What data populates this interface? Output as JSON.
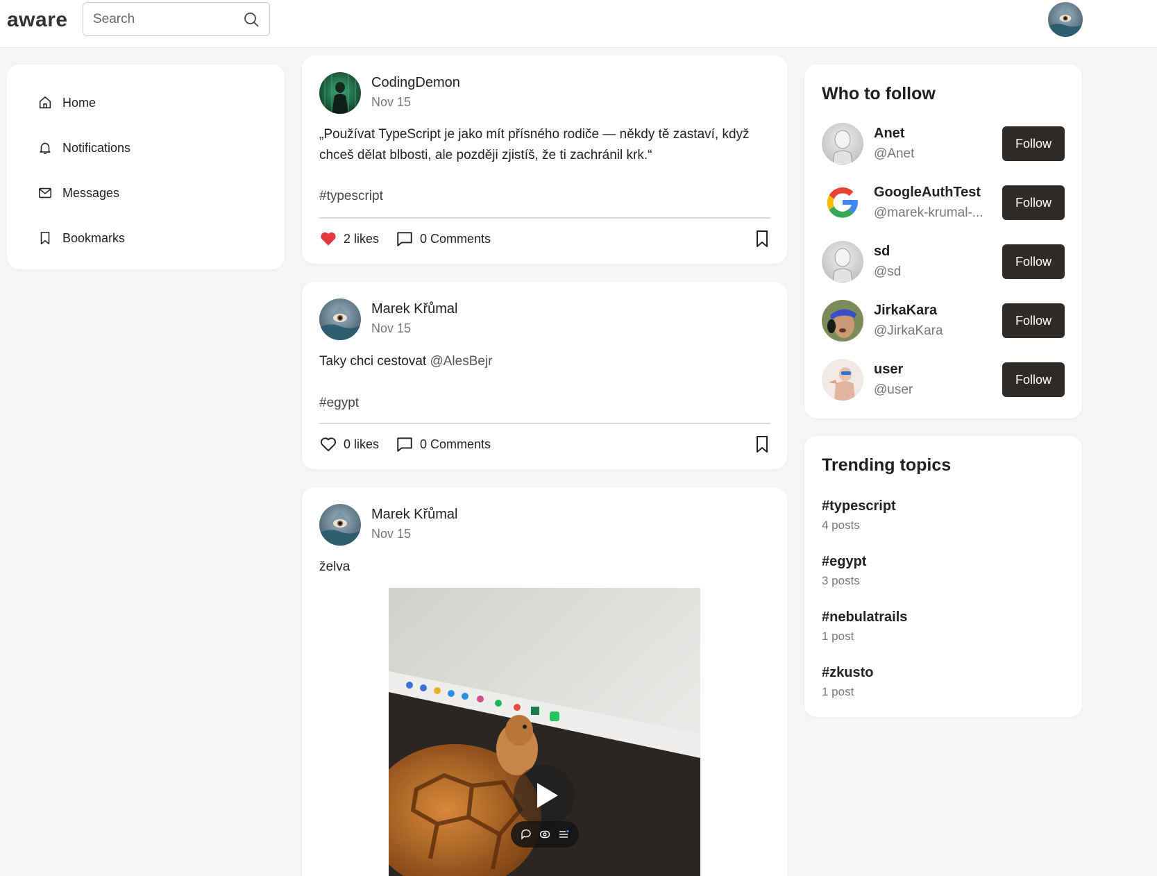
{
  "app": {
    "logo": "aware"
  },
  "search": {
    "placeholder": "Search"
  },
  "nav": {
    "items": [
      {
        "label": "Home",
        "icon": "home-icon"
      },
      {
        "label": "Notifications",
        "icon": "bell-icon"
      },
      {
        "label": "Messages",
        "icon": "mail-icon"
      },
      {
        "label": "Bookmarks",
        "icon": "bookmark-icon"
      }
    ]
  },
  "posts": [
    {
      "author": "CodingDemon",
      "date": "Nov 15",
      "text": "„Používat TypeScript je jako mít přísného rodiče — někdy tě zastaví, když chceš dělat blbosti, ale později zjistíš, že ti zachránil krk.“",
      "hashtag": "#typescript",
      "likes": "2 likes",
      "liked": true,
      "comments": "0 Comments"
    },
    {
      "author": "Marek Křůmal",
      "date": "Nov 15",
      "text": "Taky chci cestovat ",
      "mention": "@AlesBejr",
      "hashtag": "#egypt",
      "likes": "0 likes",
      "liked": false,
      "comments": "0 Comments"
    },
    {
      "author": "Marek Křůmal",
      "date": "Nov 15",
      "text": "želva",
      "has_video": true
    }
  ],
  "who_to_follow": {
    "title": "Who to follow",
    "button_label": "Follow",
    "users": [
      {
        "name": "Anet",
        "handle": "@Anet"
      },
      {
        "name": "GoogleAuthTest",
        "handle": "@marek-krumal-..."
      },
      {
        "name": "sd",
        "handle": "@sd"
      },
      {
        "name": "JirkaKara",
        "handle": "@JirkaKara"
      },
      {
        "name": "user",
        "handle": "@user"
      }
    ]
  },
  "trending": {
    "title": "Trending topics",
    "topics": [
      {
        "tag": "#typescript",
        "count": "4 posts"
      },
      {
        "tag": "#egypt",
        "count": "3 posts"
      },
      {
        "tag": "#nebulatrails",
        "count": "1 post"
      },
      {
        "tag": "#zkusto",
        "count": "1 post"
      }
    ]
  },
  "colors": {
    "accent_dark": "#2e2b28",
    "like_red": "#e0383e",
    "page_bg": "#f5f5f5"
  }
}
